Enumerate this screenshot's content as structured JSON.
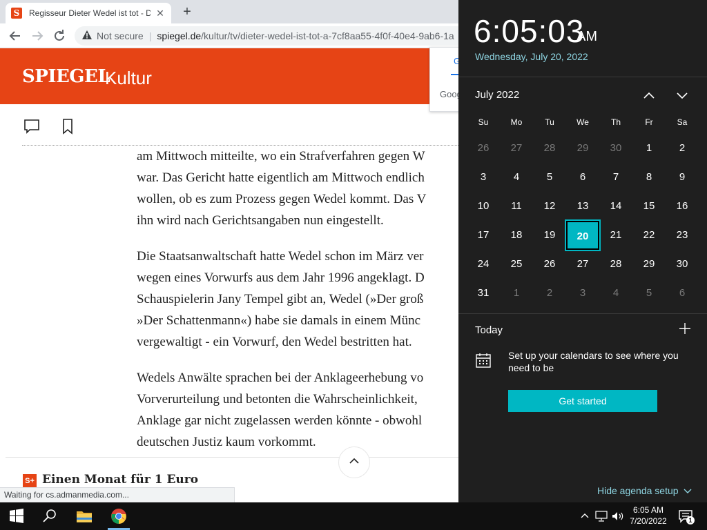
{
  "browser": {
    "tab_title": "Regisseur Dieter Wedel ist tot - D",
    "tab_favicon": "S",
    "new_tab_label": "+",
    "close_tab_label": "✕",
    "security_label": "Not secure",
    "url_host": "spiegel.de",
    "url_path": "/kultur/tv/dieter-wedel-ist-tot-a-7cf8aa55-4f0f-40e4-9ab6-1a",
    "status_text": "Waiting for cs.admanmedia.com...",
    "google_popup": {
      "tab1": "G",
      "tab2": "Goog"
    }
  },
  "page": {
    "logo": "SPIEGEL",
    "section": "Kultur",
    "paragraphs": [
      [
        "am Mittwoch mitteilte, wo ein Strafverfahren gegen W",
        "war. Das Gericht hatte eigentlich am Mittwoch endlich",
        "wollen, ob es zum Prozess gegen Wedel kommt. Das V",
        "ihn wird nach Gerichtsangaben nun eingestellt."
      ],
      [
        "Die Staatsanwaltschaft hatte Wedel schon im März ver",
        "wegen eines Vorwurfs aus dem Jahr 1996 angeklagt. D",
        "Schauspielerin Jany Tempel gibt an, Wedel (»Der groß",
        "»Der Schattenmann«) habe sie damals in einem Münc",
        "vergewaltigt - ein Vorwurf, den Wedel bestritten hat."
      ],
      [
        "Wedels Anwälte sprachen bei der Anklageerhebung vo",
        "Vorverurteilung und betonten die Wahrscheinlichkeit,",
        "Anklage gar nicht zugelassen werden könnte - obwohl",
        "deutschen Justiz kaum vorkommt."
      ]
    ],
    "promo_badge": "S+",
    "promo_text": "Einen Monat für 1 Euro"
  },
  "calendar": {
    "time": "6:05:03",
    "ampm": "AM",
    "date_long": "Wednesday, July 20, 2022",
    "month_label": "July 2022",
    "weekdays": [
      "Su",
      "Mo",
      "Tu",
      "We",
      "Th",
      "Fr",
      "Sa"
    ],
    "weeks": [
      [
        "26",
        "27",
        "28",
        "29",
        "30",
        "1",
        "2"
      ],
      [
        "3",
        "4",
        "5",
        "6",
        "7",
        "8",
        "9"
      ],
      [
        "10",
        "11",
        "12",
        "13",
        "14",
        "15",
        "16"
      ],
      [
        "17",
        "18",
        "19",
        "20",
        "21",
        "22",
        "23"
      ],
      [
        "24",
        "25",
        "26",
        "27",
        "28",
        "29",
        "30"
      ],
      [
        "31",
        "1",
        "2",
        "3",
        "4",
        "5",
        "6"
      ]
    ],
    "dim_cells": [
      [
        0,
        0
      ],
      [
        0,
        1
      ],
      [
        0,
        2
      ],
      [
        0,
        3
      ],
      [
        0,
        4
      ],
      [
        5,
        1
      ],
      [
        5,
        2
      ],
      [
        5,
        3
      ],
      [
        5,
        4
      ],
      [
        5,
        5
      ],
      [
        5,
        6
      ]
    ],
    "selected_cell": [
      3,
      3
    ],
    "accent": "#00b7c3",
    "today_label": "Today",
    "setup_text": "Set up your calendars to see where you need to be",
    "get_started_label": "Get started",
    "hide_agenda_label": "Hide agenda setup"
  },
  "taskbar": {
    "time": "6:05 AM",
    "date": "7/20/2022",
    "notification_count": "1"
  }
}
